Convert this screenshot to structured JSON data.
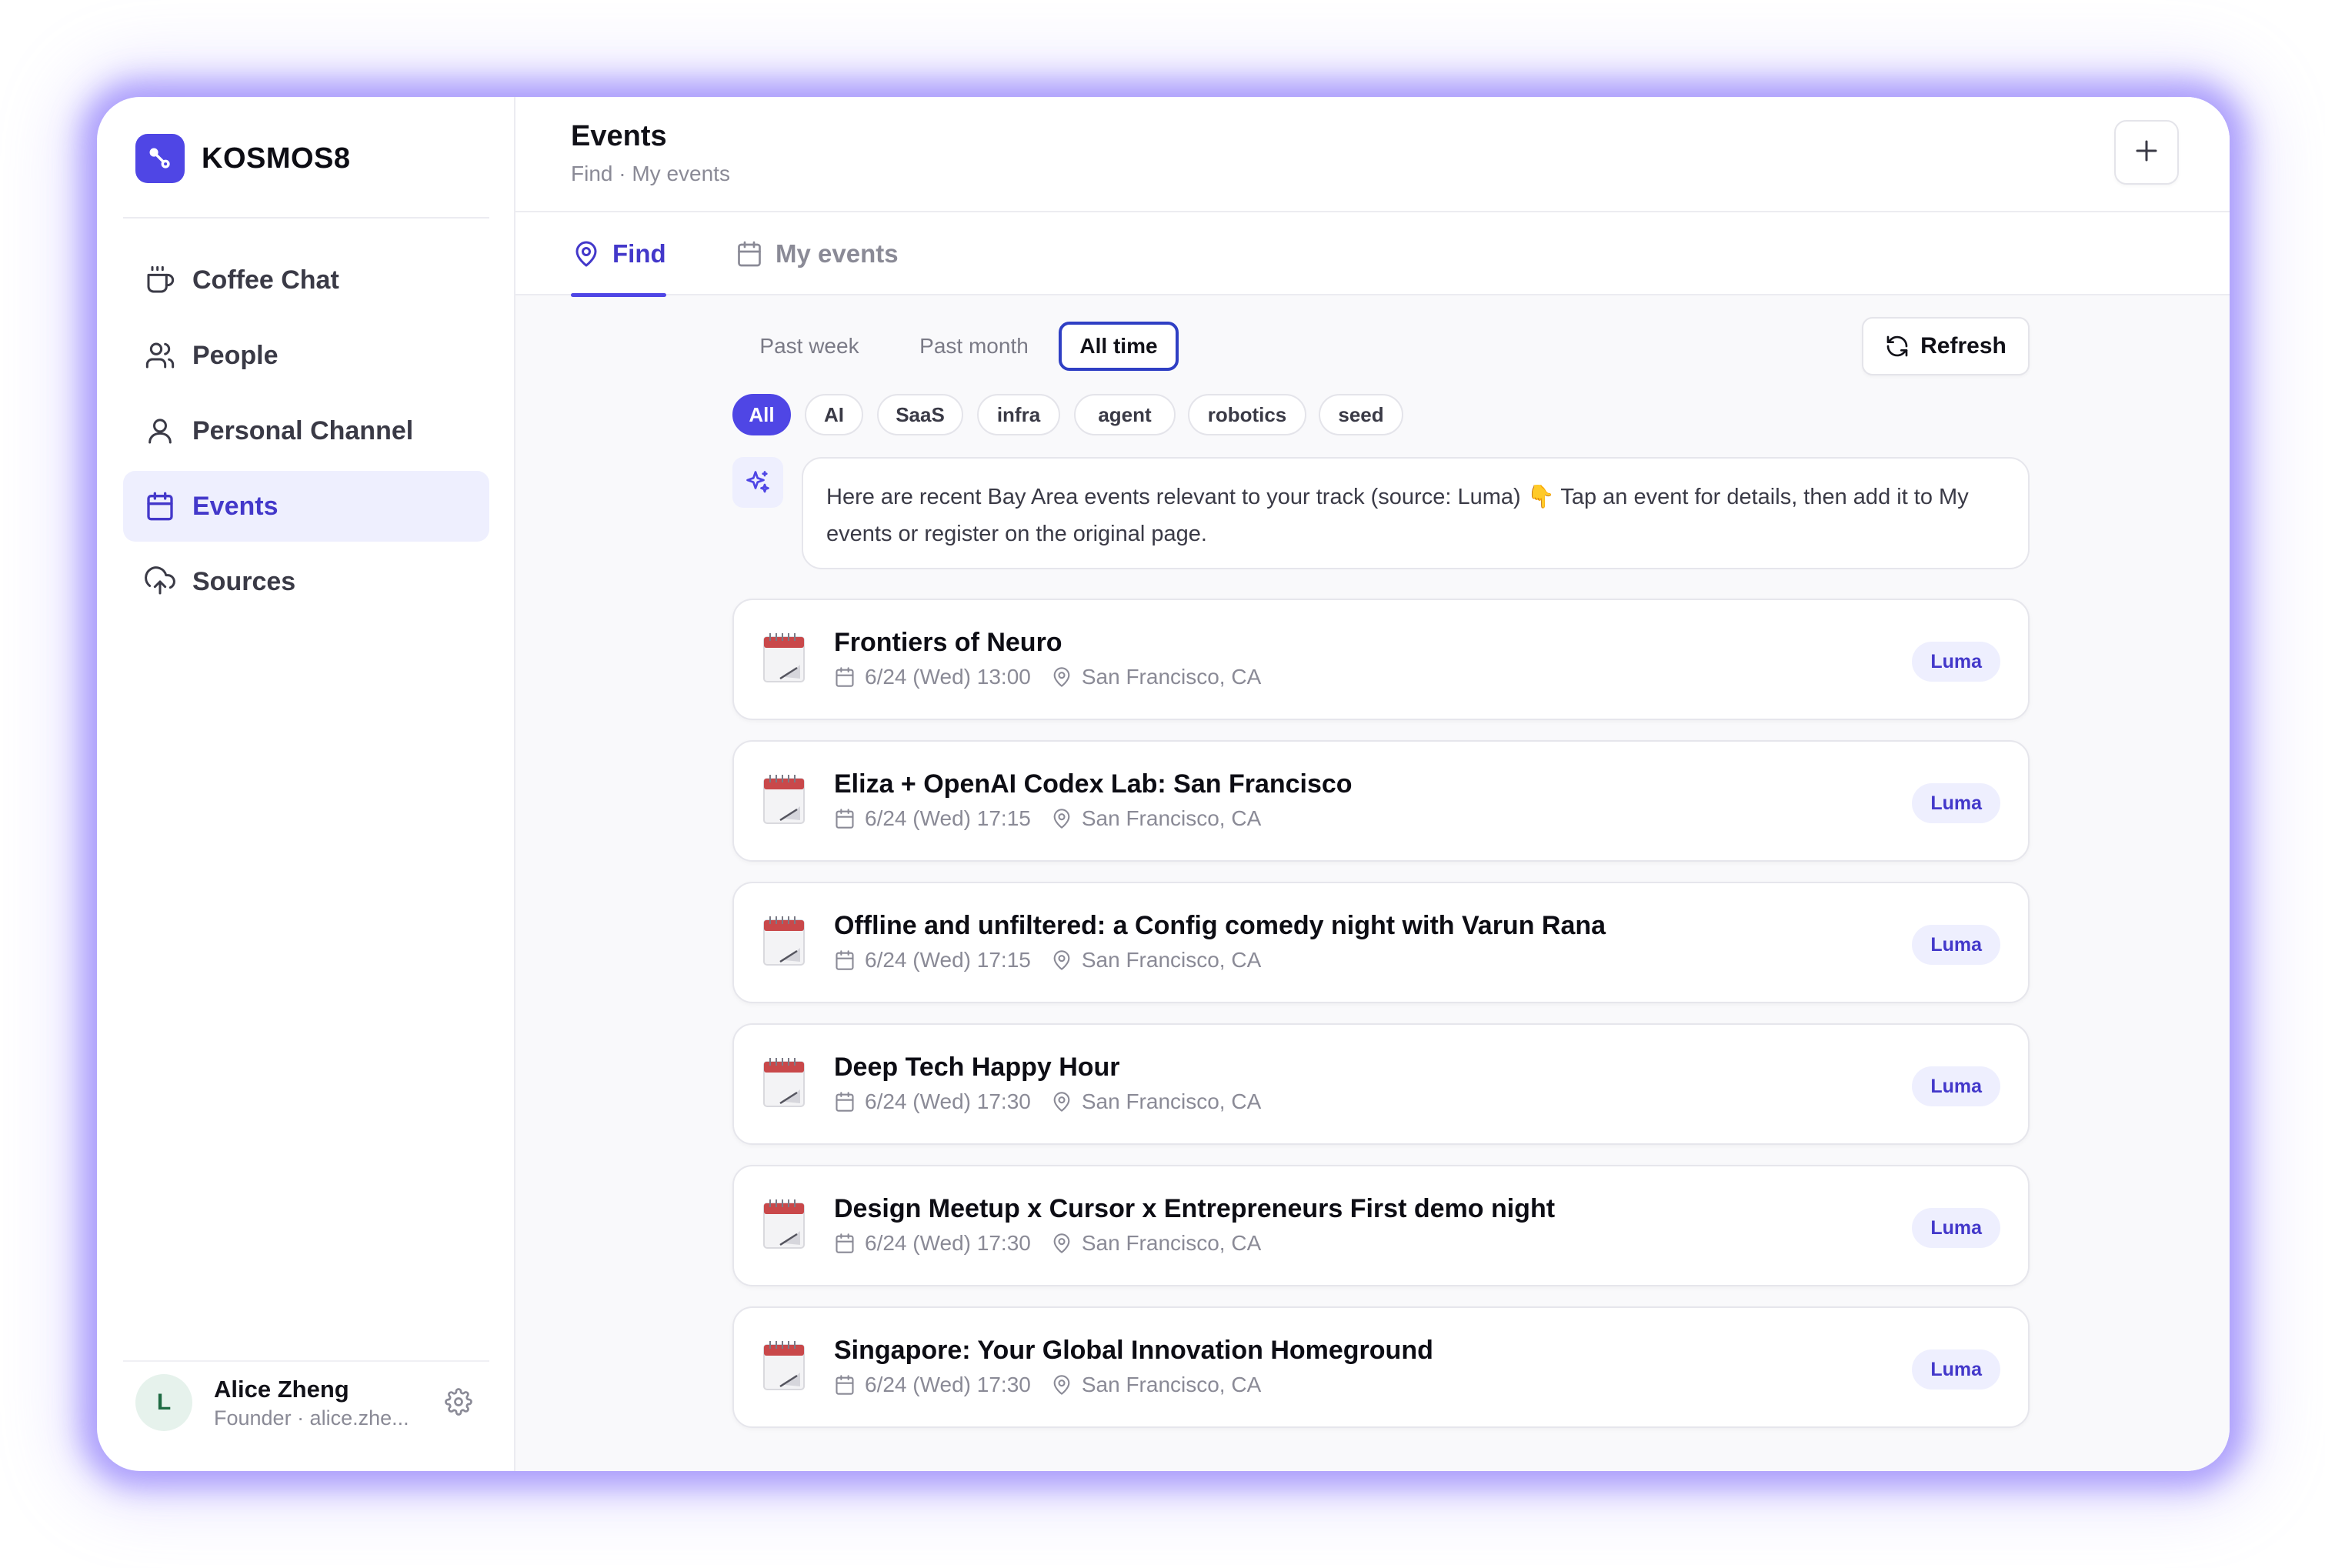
{
  "app": {
    "name": "KOSMOS8",
    "accent": "#4f46e5"
  },
  "sidebar": {
    "items": [
      {
        "label": "Coffee Chat",
        "icon": "coffee-cup-icon"
      },
      {
        "label": "People",
        "icon": "people-icon"
      },
      {
        "label": "Personal Channel",
        "icon": "person-icon"
      },
      {
        "label": "Events",
        "icon": "calendar-icon",
        "active": true
      },
      {
        "label": "Sources",
        "icon": "cloud-upload-icon"
      }
    ],
    "user": {
      "initial": "L",
      "name": "Alice Zheng",
      "subtitle": "Founder · alice.zhe..."
    }
  },
  "header": {
    "title": "Events",
    "breadcrumb": "Find · My events"
  },
  "tabs": [
    {
      "label": "Find",
      "icon": "map-pin-icon",
      "active": true
    },
    {
      "label": "My events",
      "icon": "calendar-icon",
      "active": false
    }
  ],
  "filters": {
    "ranges": [
      {
        "label": "Past week",
        "active": false
      },
      {
        "label": "Past month",
        "active": false
      },
      {
        "label": "All time",
        "active": true
      }
    ],
    "refresh_label": "Refresh",
    "tags": [
      {
        "label": "All",
        "active": true
      },
      {
        "label": "AI",
        "active": false
      },
      {
        "label": "SaaS",
        "active": false
      },
      {
        "label": "infra",
        "active": false
      },
      {
        "label": "agent",
        "active": false
      },
      {
        "label": "robotics",
        "active": false
      },
      {
        "label": "seed",
        "active": false
      }
    ]
  },
  "assistant": {
    "message": "Here are recent Bay Area events relevant to your track (source: Luma) 👇 Tap an event for details, then add it to My events or register on the original page."
  },
  "events": [
    {
      "title": "Frontiers of Neuro",
      "datetime": "6/24 (Wed) 13:00",
      "location": "San Francisco, CA",
      "source": "Luma"
    },
    {
      "title": "Eliza + OpenAI Codex Lab: San Francisco",
      "datetime": "6/24 (Wed) 17:15",
      "location": "San Francisco, CA",
      "source": "Luma"
    },
    {
      "title": "Offline and unfiltered: a Config comedy night with Varun Rana",
      "datetime": "6/24 (Wed) 17:15",
      "location": "San Francisco, CA",
      "source": "Luma"
    },
    {
      "title": "Deep Tech Happy Hour",
      "datetime": "6/24 (Wed) 17:30",
      "location": "San Francisco, CA",
      "source": "Luma"
    },
    {
      "title": "Design Meetup x Cursor x Entrepreneurs First demo night",
      "datetime": "6/24 (Wed) 17:30",
      "location": "San Francisco, CA",
      "source": "Luma"
    },
    {
      "title": "Singapore: Your Global Innovation Homeground",
      "datetime": "6/24 (Wed) 17:30",
      "location": "San Francisco, CA",
      "source": "Luma"
    }
  ]
}
